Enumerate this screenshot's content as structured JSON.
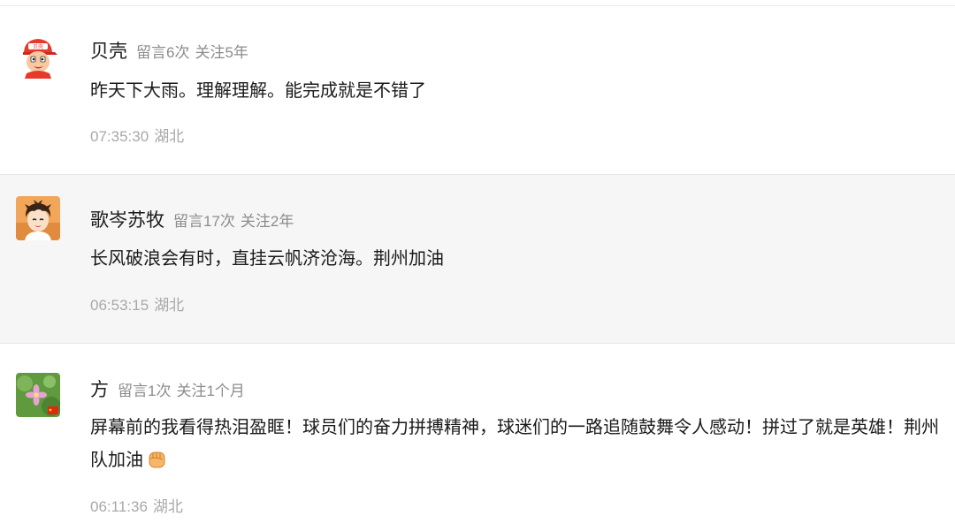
{
  "comments": [
    {
      "nickname": "贝壳",
      "message_count": "留言6次",
      "follow_time": "关注5年",
      "content": "昨天下大雨。理解理解。能完成就是不错了",
      "time": "07:35:30",
      "location": "湖北",
      "avatar_icon": "cartoon-boy-red-cap-avatar",
      "avatar_text": "贝壳"
    },
    {
      "nickname": "歌岑苏牧",
      "message_count": "留言17次",
      "follow_time": "关注2年",
      "content": "长风破浪会有时，直挂云帆济沧海。荆州加油",
      "time": "06:53:15",
      "location": "湖北",
      "avatar_icon": "anime-character-avatar"
    },
    {
      "nickname": "方",
      "message_count": "留言1次",
      "follow_time": "关注1个月",
      "content": "屏幕前的我看得热泪盈眶！球员们的奋力拼搏精神，球迷们的一路追随鼓舞令人感动！拼过了就是英雄！荆州队加油",
      "content_emoji": "fist-emoji",
      "time": "06:11:36",
      "location": "湖北",
      "avatar_icon": "pink-flower-avatar"
    }
  ],
  "colors": {
    "text": "#1a1a1a",
    "meta": "#8c8c8c",
    "footer": "#a8a8a8",
    "alt_row": "#f6f6f6"
  }
}
